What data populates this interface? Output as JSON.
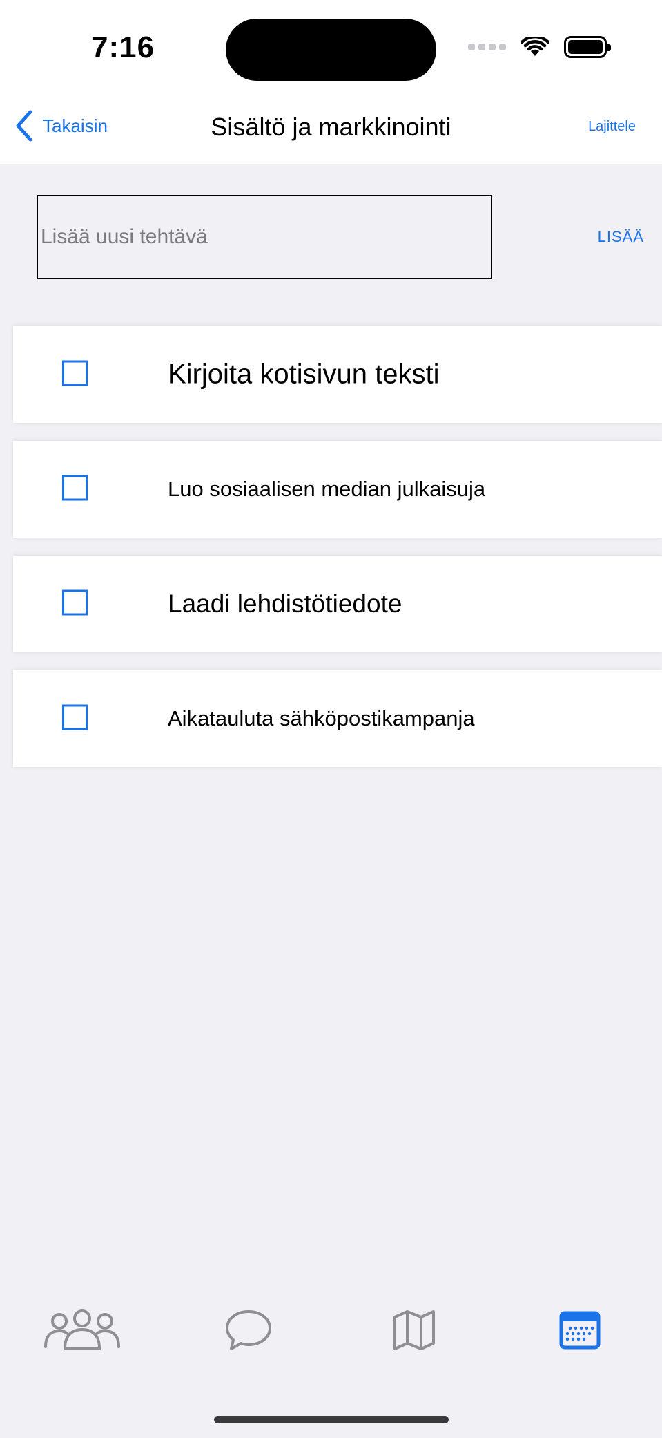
{
  "status_bar": {
    "time": "7:16"
  },
  "nav": {
    "back_label": "Takaisin",
    "title": "Sisältö ja markkinointi",
    "sort_label": "Lajittele"
  },
  "add_task": {
    "placeholder": "Lisää uusi tehtävä",
    "value": "",
    "button_label": "LISÄÄ"
  },
  "tasks": [
    {
      "title": "Kirjoita kotisivun teksti",
      "checked": false
    },
    {
      "title": "Luo sosiaalisen median julkaisuja",
      "checked": false
    },
    {
      "title": "Laadi lehdistötiedote",
      "checked": false
    },
    {
      "title": "Aikatauluta sähköpostikampanja",
      "checked": false
    }
  ],
  "tab_bar": {
    "tabs": [
      {
        "icon": "people-icon",
        "active": false
      },
      {
        "icon": "chat-bubble-icon",
        "active": false
      },
      {
        "icon": "map-icon",
        "active": false
      },
      {
        "icon": "calendar-icon",
        "active": true
      }
    ]
  },
  "colors": {
    "accent": "#1a73e8",
    "background": "#f0f0f5",
    "card": "#ffffff",
    "inactive_icon": "#8e8e93"
  }
}
